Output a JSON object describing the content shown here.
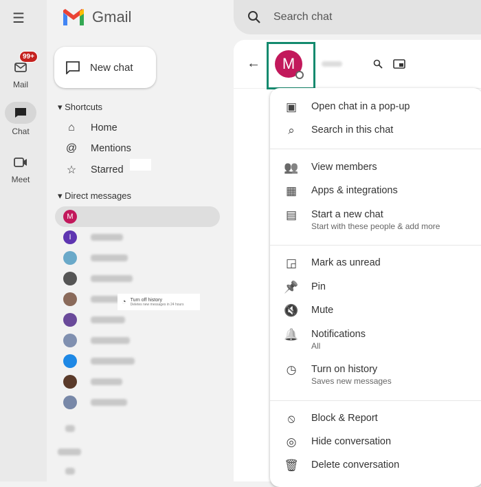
{
  "rail": {
    "items": [
      {
        "label": "Mail",
        "badge": "99+"
      },
      {
        "label": "Chat"
      },
      {
        "label": "Meet"
      }
    ]
  },
  "app": {
    "name": "Gmail"
  },
  "new_chat": "New chat",
  "shortcuts": {
    "heading": "Shortcuts",
    "items": [
      {
        "label": "Home",
        "icon": "home-icon"
      },
      {
        "label": "Mentions",
        "icon": "at-icon"
      },
      {
        "label": "Starred",
        "icon": "star-icon"
      }
    ]
  },
  "direct_messages": {
    "heading": "Direct messages",
    "items": [
      {
        "avatar": "M",
        "color": "#c2185b",
        "selected": true
      },
      {
        "avatar": "I",
        "color": "#5e35b1"
      },
      {
        "avatar": "",
        "color": "#6aa9c9"
      },
      {
        "avatar": "",
        "color": "#555555"
      },
      {
        "avatar": "",
        "color": "#8a6a5a"
      },
      {
        "avatar": "",
        "color": "#6a4a9a"
      },
      {
        "avatar": "",
        "color": "#8090b0"
      },
      {
        "avatar": "",
        "color": "#1e88e5"
      },
      {
        "avatar": "",
        "color": "#5a3a2a"
      },
      {
        "avatar": "",
        "color": "#7888a8"
      }
    ]
  },
  "tooltip": {
    "title": "Turn off history",
    "subtitle": "Deletes new messages in 24 hours"
  },
  "search": {
    "placeholder": "Search chat"
  },
  "chat_header": {
    "avatar": "M",
    "avatar_color": "#c2185b",
    "highlight_color": "#138a6e"
  },
  "menu": {
    "groups": [
      [
        {
          "label": "Open chat in a pop-up",
          "icon": "popup-icon"
        },
        {
          "label": "Search in this chat",
          "icon": "search-icon"
        }
      ],
      [
        {
          "label": "View members",
          "icon": "members-icon"
        },
        {
          "label": "Apps & integrations",
          "icon": "apps-icon"
        },
        {
          "label": "Start a new chat",
          "sub": "Start with these people & add more",
          "icon": "chat-icon"
        }
      ],
      [
        {
          "label": "Mark as unread",
          "icon": "mark-unread-icon"
        },
        {
          "label": "Pin",
          "icon": "pin-icon"
        },
        {
          "label": "Mute",
          "icon": "mute-icon"
        },
        {
          "label": "Notifications",
          "sub": "All",
          "icon": "bell-icon"
        },
        {
          "label": "Turn on history",
          "sub": "Saves new messages",
          "icon": "history-icon"
        }
      ],
      [
        {
          "label": "Block & Report",
          "icon": "block-icon"
        },
        {
          "label": "Hide conversation",
          "icon": "hide-icon"
        },
        {
          "label": "Delete conversation",
          "icon": "trash-icon"
        }
      ]
    ]
  }
}
